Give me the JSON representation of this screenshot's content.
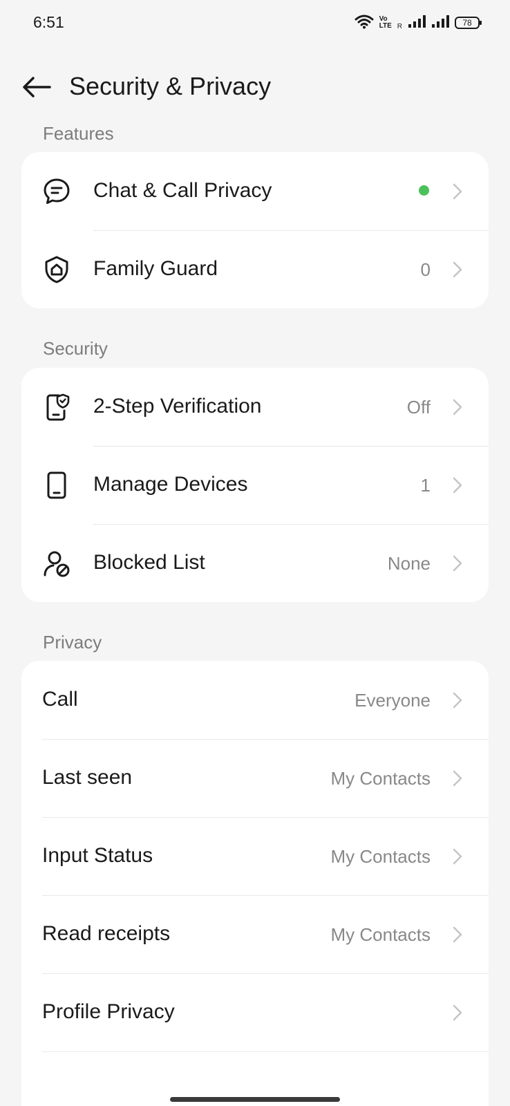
{
  "status_bar": {
    "time": "6:51",
    "volte_label_top": "Vo",
    "volte_label_bottom": "LTE",
    "roaming_label": "R",
    "battery": "78",
    "icons": [
      "wifi-icon",
      "volte-icon",
      "signal-icon",
      "signal-icon",
      "battery-icon"
    ]
  },
  "header": {
    "title": "Security & Privacy",
    "back_icon": "arrow-left-icon"
  },
  "sections": {
    "features": {
      "label": "Features",
      "items": [
        {
          "label": "Chat & Call Privacy",
          "icon": "chat-bubble-icon",
          "status_color": "#4cc15a"
        },
        {
          "label": "Family Guard",
          "icon": "shield-home-icon",
          "value": "0"
        }
      ]
    },
    "security": {
      "label": "Security",
      "items": [
        {
          "label": "2-Step Verification",
          "icon": "phone-shield-icon",
          "value": "Off"
        },
        {
          "label": "Manage Devices",
          "icon": "phone-icon",
          "value": "1"
        },
        {
          "label": "Blocked List",
          "icon": "user-blocked-icon",
          "value": "None"
        }
      ]
    },
    "privacy": {
      "label": "Privacy",
      "items": [
        {
          "label": "Call",
          "value": "Everyone"
        },
        {
          "label": "Last seen",
          "value": "My Contacts"
        },
        {
          "label": "Input Status",
          "value": "My Contacts"
        },
        {
          "label": "Read receipts",
          "value": "My Contacts"
        },
        {
          "label": "Profile Privacy",
          "value": ""
        }
      ]
    }
  },
  "colors": {
    "background": "#f5f5f5",
    "card": "#ffffff",
    "accent_green": "#4cc15a",
    "secondary_text": "#888888"
  }
}
